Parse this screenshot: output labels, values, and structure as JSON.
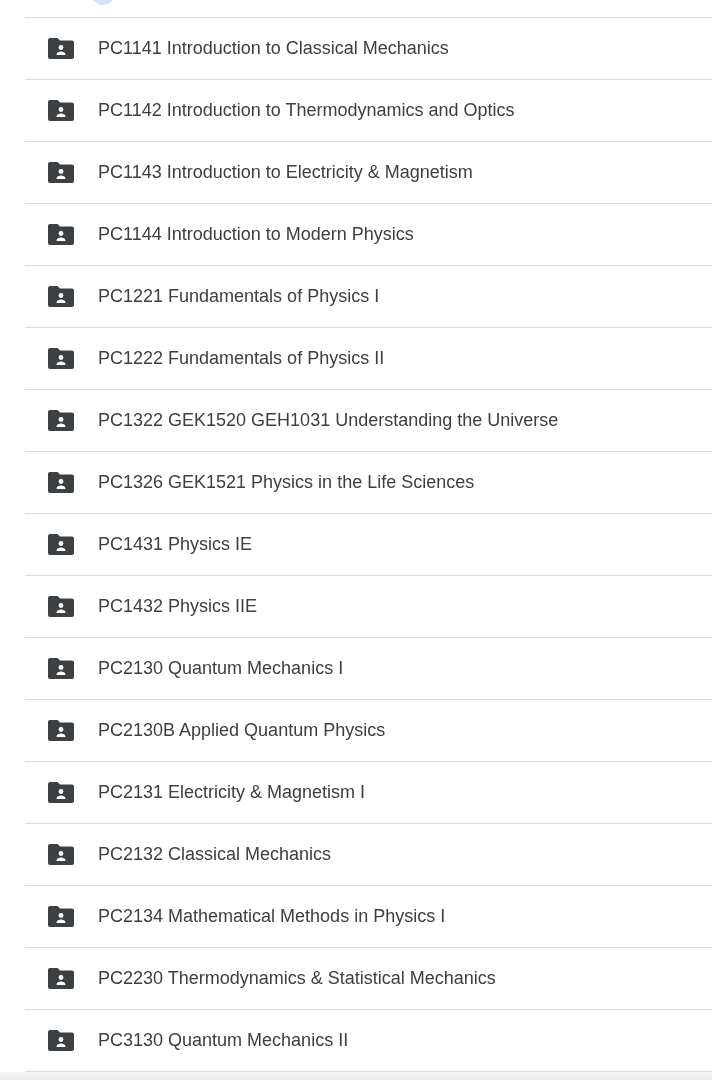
{
  "folders": [
    {
      "name": "PC1141 Introduction to Classical Mechanics"
    },
    {
      "name": "PC1142 Introduction to Thermodynamics and Optics"
    },
    {
      "name": "PC1143 Introduction to Electricity & Magnetism"
    },
    {
      "name": "PC1144 Introduction to Modern Physics"
    },
    {
      "name": "PC1221 Fundamentals of Physics I"
    },
    {
      "name": "PC1222 Fundamentals of Physics II"
    },
    {
      "name": "PC1322 GEK1520 GEH1031 Understanding the Universe"
    },
    {
      "name": "PC1326 GEK1521 Physics in the Life Sciences"
    },
    {
      "name": "PC1431 Physics IE"
    },
    {
      "name": "PC1432 Physics IIE"
    },
    {
      "name": "PC2130 Quantum Mechanics I"
    },
    {
      "name": "PC2130B Applied Quantum Physics"
    },
    {
      "name": "PC2131 Electricity & Magnetism I"
    },
    {
      "name": "PC2132 Classical Mechanics"
    },
    {
      "name": "PC2134 Mathematical Methods in Physics I"
    },
    {
      "name": "PC2230 Thermodynamics & Statistical Mechanics"
    },
    {
      "name": "PC3130 Quantum Mechanics II"
    }
  ]
}
